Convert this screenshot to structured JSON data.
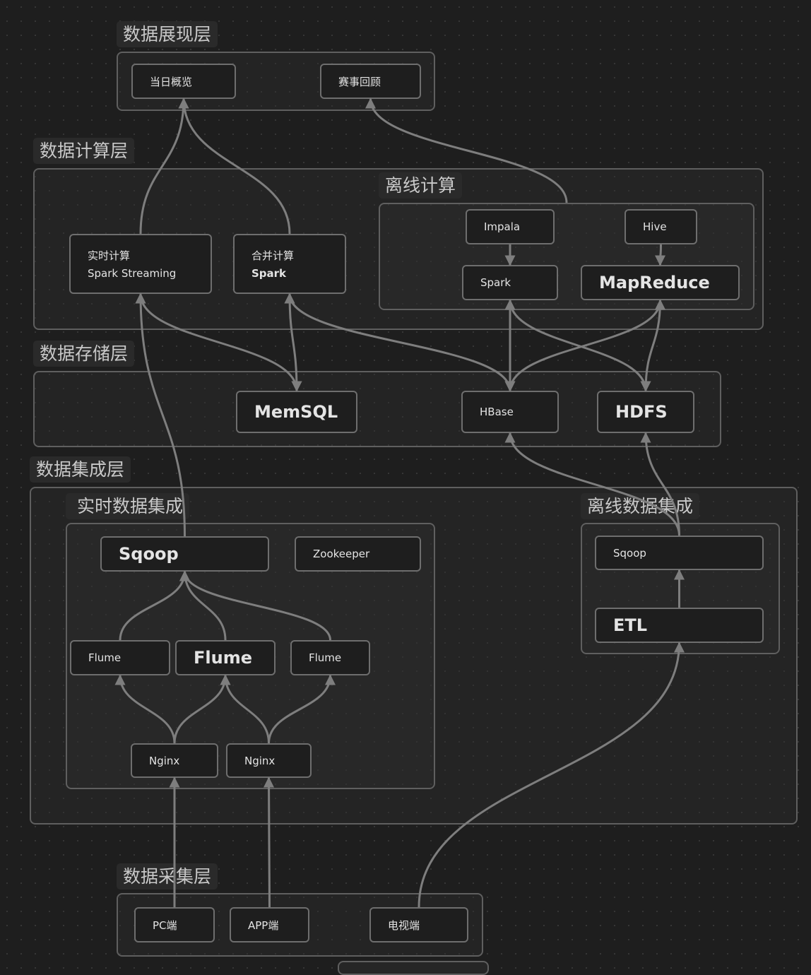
{
  "colors": {
    "background": "#1e1e1e",
    "edge": "#7e7e7e",
    "node_border": "#6e6e6e",
    "text": "#e4e4e4"
  },
  "groups": {
    "presentation": "数据展现层",
    "compute": "数据计算层",
    "offline_compute": "离线计算",
    "storage": "数据存储层",
    "integration": "数据集成层",
    "realtime_integration": "实时数据集成",
    "offline_integration": "离线数据集成",
    "collection": "数据采集层"
  },
  "nodes": {
    "daily_overview": "当日概览",
    "match_review": "赛事回顾",
    "realtime_compute": {
      "title": "实时计算",
      "subtitle": "Spark Streaming"
    },
    "merge_compute": {
      "title": "合并计算",
      "subtitle": "Spark"
    },
    "impala": "Impala",
    "hive": "Hive",
    "spark": "Spark",
    "mapreduce": "MapReduce",
    "memsql": "MemSQL",
    "hbase": "HBase",
    "hdfs": "HDFS",
    "sqoop_rt": "Sqoop",
    "zookeeper": "Zookeeper",
    "flume1": "Flume",
    "flume2": "Flume",
    "flume3": "Flume",
    "nginx1": "Nginx",
    "nginx2": "Nginx",
    "sqoop_off": "Sqoop",
    "etl": "ETL",
    "pc": "PC端",
    "app": "APP端",
    "tv": "电视端"
  }
}
